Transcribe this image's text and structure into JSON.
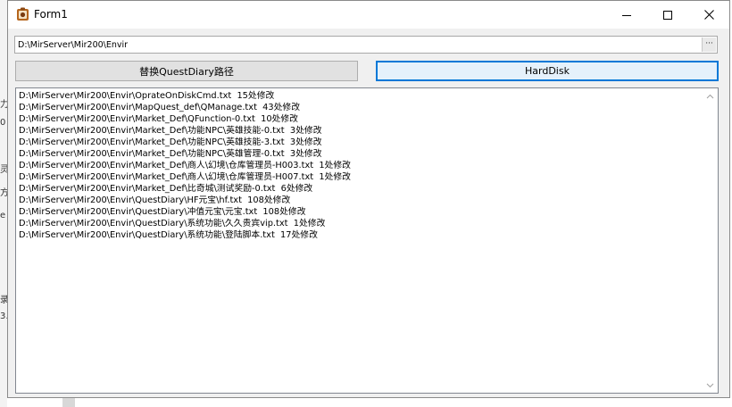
{
  "window": {
    "title": "Form1"
  },
  "path_input": {
    "value": "D:\\MirServer\\Mir200\\Envir",
    "browse_label": "···"
  },
  "buttons": {
    "replace_label": "替换QuestDiary路径",
    "harddisk_label": "HardDisk"
  },
  "log_lines": [
    "D:\\MirServer\\Mir200\\Envir\\OprateOnDiskCmd.txt  15处修改",
    "D:\\MirServer\\Mir200\\Envir\\MapQuest_def\\QManage.txt  43处修改",
    "D:\\MirServer\\Mir200\\Envir\\Market_Def\\QFunction-0.txt  10处修改",
    "D:\\MirServer\\Mir200\\Envir\\Market_Def\\功能NPC\\英雄技能-0.txt  3处修改",
    "D:\\MirServer\\Mir200\\Envir\\Market_Def\\功能NPC\\英雄技能-3.txt  3处修改",
    "D:\\MirServer\\Mir200\\Envir\\Market_Def\\功能NPC\\英雄管理-0.txt  3处修改",
    "D:\\MirServer\\Mir200\\Envir\\Market_Def\\商人\\幻境\\仓库管理员-H003.txt  1处修改",
    "D:\\MirServer\\Mir200\\Envir\\Market_Def\\商人\\幻境\\仓库管理员-H007.txt  1处修改",
    "D:\\MirServer\\Mir200\\Envir\\Market_Def\\比奇城\\测试奖励-0.txt  6处修改",
    "D:\\MirServer\\Mir200\\Envir\\QuestDiary\\HF元宝\\hf.txt  108处修改",
    "D:\\MirServer\\Mir200\\Envir\\QuestDiary\\冲值元宝\\元宝.txt  108处修改",
    "D:\\MirServer\\Mir200\\Envir\\QuestDiary\\系统功能\\久久贵宾vip.txt  1处修改",
    "D:\\MirServer\\Mir200\\Envir\\QuestDiary\\系统功能\\登陆脚本.txt  17处修改"
  ],
  "background_fragments": [
    "力",
    "0",
    "灵",
    "方",
    "e",
    "录",
    "3."
  ]
}
